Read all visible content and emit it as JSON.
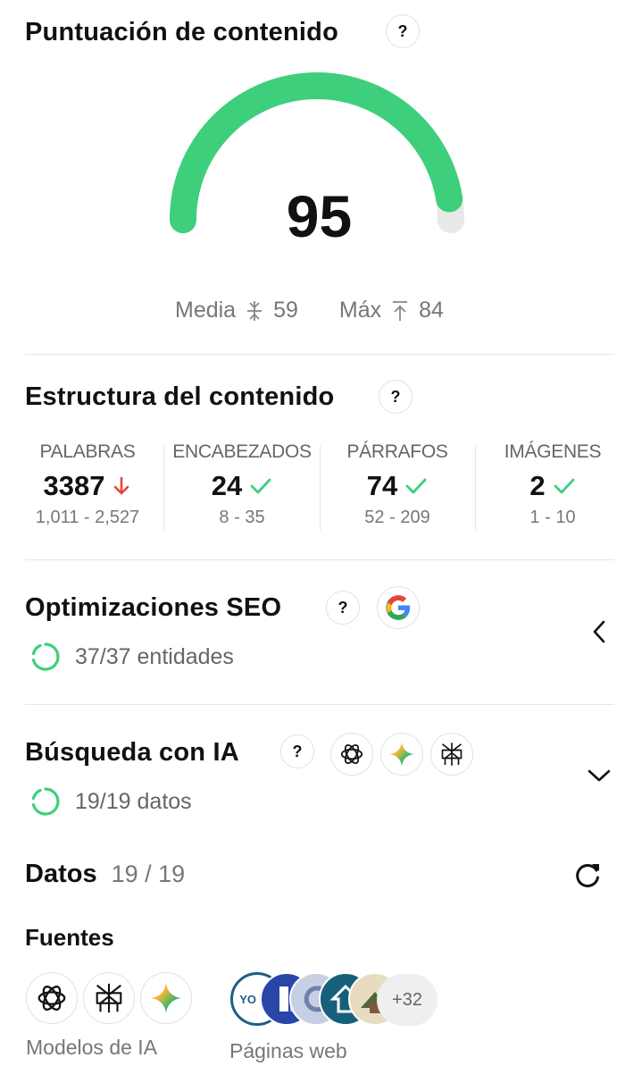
{
  "score_section": {
    "title": "Puntuación de contenido",
    "help": "?",
    "score": "95",
    "score_fraction": 0.95,
    "avg_label": "Media",
    "avg_value": "59",
    "max_label": "Máx",
    "max_value": "84",
    "colors": {
      "progress": "#3ecf7c",
      "track": "#e8e8e8"
    }
  },
  "structure": {
    "title": "Estructura del contenido",
    "help": "?",
    "metrics": [
      {
        "label": "PALABRAS",
        "value": "3387",
        "status": "down",
        "range": "1,011 - 2,527"
      },
      {
        "label": "ENCABEZADOS",
        "value": "24",
        "status": "ok",
        "range": "8 - 35"
      },
      {
        "label": "PÁRRAFOS",
        "value": "74",
        "status": "ok",
        "range": "52 - 209"
      },
      {
        "label": "IMÁGENES",
        "value": "2",
        "status": "ok",
        "range": "1 - 10"
      }
    ],
    "colors": {
      "ok": "#3ecf7c",
      "down": "#e5483a"
    }
  },
  "seo": {
    "title": "Optimizaciones SEO",
    "help": "?",
    "logo_icon": "google-logo-icon",
    "progress_text": "37/37 entidades"
  },
  "ai_search": {
    "title": "Búsqueda con IA",
    "help": "?",
    "logo_icons": [
      "openai-logo-icon",
      "gemini-logo-icon",
      "perplexity-logo-icon"
    ],
    "progress_text": "19/19 datos"
  },
  "datos": {
    "title": "Datos",
    "count": "19 / 19",
    "refresh_icon": "refresh-icon"
  },
  "fuentes": {
    "title": "Fuentes",
    "ai_models_caption": "Modelos de IA",
    "web_pages_caption": "Páginas web",
    "web_logos": [
      {
        "text": "YO VA",
        "color": "#1d5e86"
      },
      {
        "text": "",
        "color": "#2945a8"
      },
      {
        "text": "",
        "color": "#9aa6c6"
      },
      {
        "text": "",
        "color": "#17607c"
      },
      {
        "text": "",
        "color": "#c9b27c"
      }
    ],
    "more": "+32"
  }
}
